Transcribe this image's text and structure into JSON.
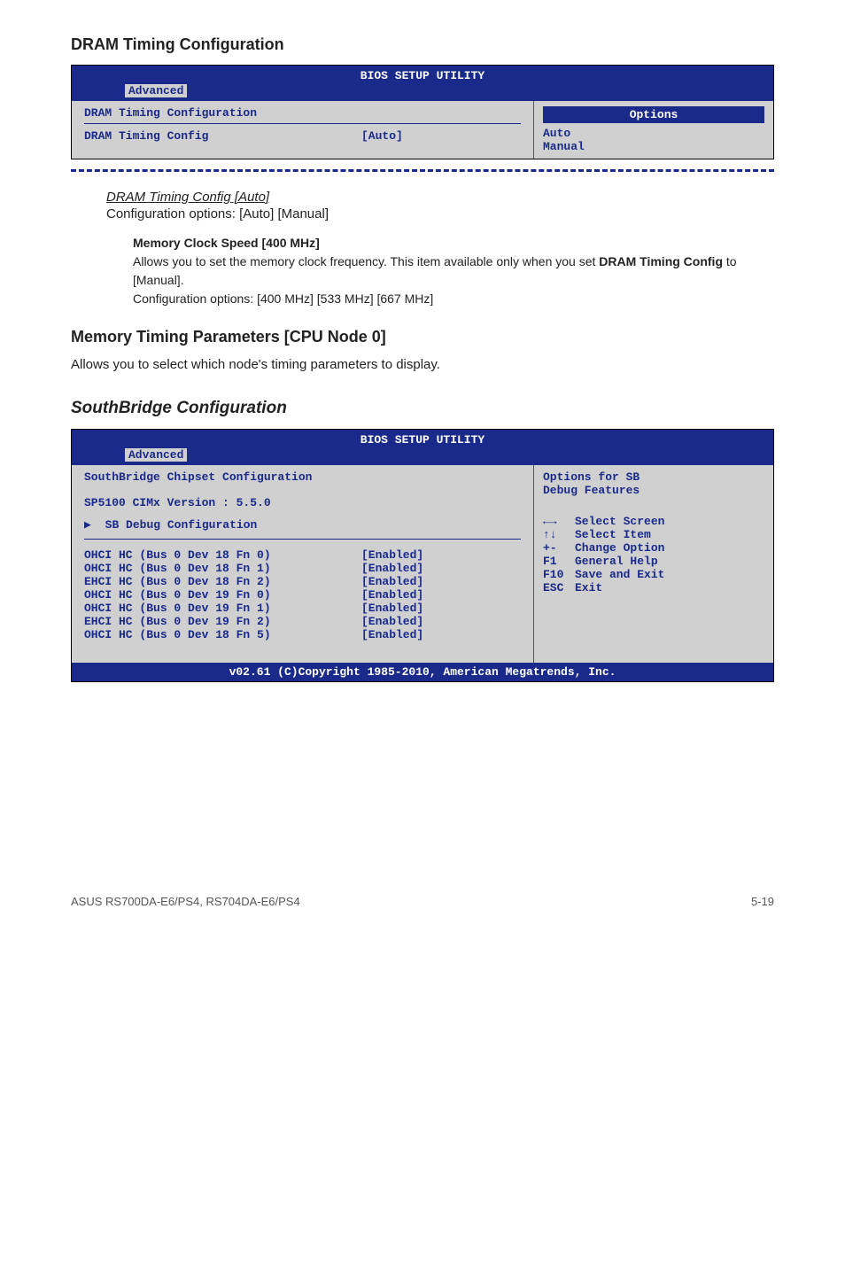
{
  "section1": {
    "heading": "DRAM Timing Configuration",
    "bios_title": "BIOS SETUP UTILITY",
    "tab": "Advanced",
    "panel_title": "DRAM Timing Configuration",
    "setting_label": "DRAM Timing Config",
    "setting_value": "[Auto]",
    "options_header": "Options",
    "option1": "Auto",
    "option2": "Manual"
  },
  "dram_config": {
    "link": "DRAM Timing Config [Auto]",
    "desc": "Configuration options: [Auto] [Manual]"
  },
  "memclk": {
    "title": "Memory Clock Speed [400 MHz]",
    "line1": "Allows you to set the memory clock frequency. This item available only when you set ",
    "bold": "DRAM Timing Config",
    "line1b": " to [Manual].",
    "line2": "Configuration options: [400 MHz] [533 MHz] [667 MHz]"
  },
  "section2": {
    "heading": "Memory Timing Parameters [CPU Node 0]",
    "desc": "Allows you to select which node's timing parameters to display."
  },
  "section3": {
    "heading": "SouthBridge Configuration",
    "bios_title": "BIOS SETUP UTILITY",
    "tab": "Advanced",
    "panel_title": "SouthBridge Chipset Configuration",
    "version": "SP5100 CIMx Version : 5.5.0",
    "sb_debug": "SB Debug Configuration",
    "rows": [
      {
        "l": "OHCI HC (Bus 0 Dev 18 Fn 0)",
        "v": "[Enabled]"
      },
      {
        "l": "OHCI HC (Bus 0 Dev 18 Fn 1)",
        "v": "[Enabled]"
      },
      {
        "l": "EHCI HC (Bus 0 Dev 18 Fn 2)",
        "v": "[Enabled]"
      },
      {
        "l": "OHCI HC (Bus 0 Dev 19 Fn 0)",
        "v": "[Enabled]"
      },
      {
        "l": "OHCI HC (Bus 0 Dev 19 Fn 1)",
        "v": "[Enabled]"
      },
      {
        "l": "EHCI HC (Bus 0 Dev 19 Fn 2)",
        "v": "[Enabled]"
      },
      {
        "l": "OHCI HC (Bus 0 Dev 18 Fn 5)",
        "v": "[Enabled]"
      }
    ],
    "side_title1": "Options for SB",
    "side_title2": "Debug Features",
    "nav": {
      "select_screen": "Select Screen",
      "select_item": "Select Item",
      "change_option": "Change Option",
      "general_help": "General Help",
      "save_exit": "Save and Exit",
      "exit": "Exit",
      "k_arrows": "←→",
      "k_updown": "↑↓",
      "k_plusminus": "+-",
      "k_f1": "F1",
      "k_f10": "F10",
      "k_esc": "ESC"
    },
    "footer": "v02.61 (C)Copyright 1985-2010, American Megatrends, Inc."
  },
  "page_footer": {
    "left": "ASUS RS700DA-E6/PS4, RS704DA-E6/PS4",
    "right": "5-19"
  }
}
